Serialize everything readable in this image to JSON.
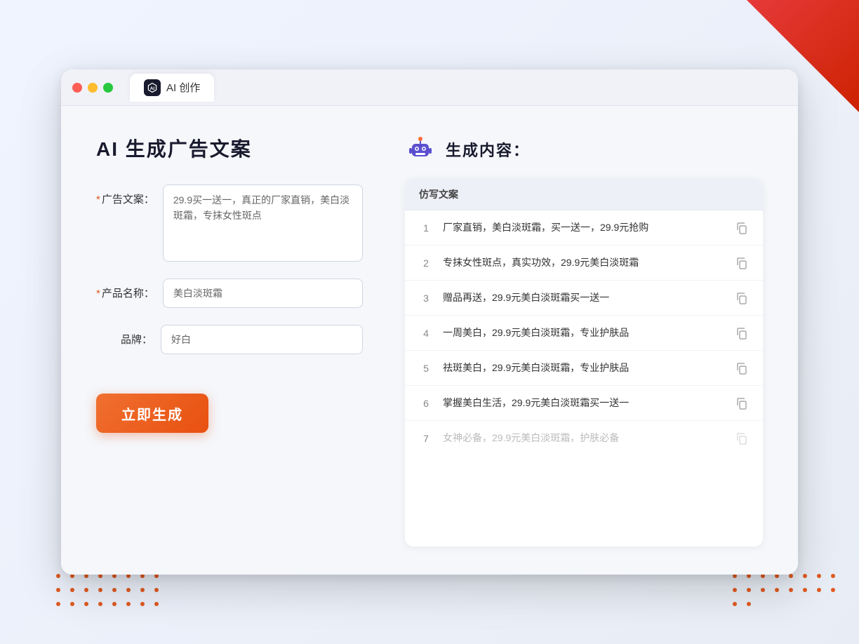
{
  "window": {
    "tab_label": "AI 创作"
  },
  "left_panel": {
    "title": "AI 生成广告文案",
    "form": {
      "ad_copy_label": "广告文案：",
      "ad_copy_required": "*",
      "ad_copy_value": "29.9买一送一，真正的厂家直销，美白淡斑霜，专抹女性斑点",
      "product_name_label": "产品名称：",
      "product_name_required": "*",
      "product_name_value": "美白淡斑霜",
      "brand_label": "品牌：",
      "brand_value": "好白"
    },
    "generate_button": "立即生成"
  },
  "right_panel": {
    "title": "生成内容：",
    "table_header": "仿写文案",
    "results": [
      {
        "num": "1",
        "text": "厂家直销，美白淡斑霜，买一送一，29.9元抢购",
        "dimmed": false
      },
      {
        "num": "2",
        "text": "专抹女性斑点，真实功效，29.9元美白淡斑霜",
        "dimmed": false
      },
      {
        "num": "3",
        "text": "赠品再送，29.9元美白淡斑霜买一送一",
        "dimmed": false
      },
      {
        "num": "4",
        "text": "一周美白，29.9元美白淡斑霜，专业护肤品",
        "dimmed": false
      },
      {
        "num": "5",
        "text": "祛斑美白，29.9元美白淡斑霜，专业护肤品",
        "dimmed": false
      },
      {
        "num": "6",
        "text": "掌握美白生活，29.9元美白淡斑霜买一送一",
        "dimmed": false
      },
      {
        "num": "7",
        "text": "女神必备，29.9元美白淡斑霜，护肤必备",
        "dimmed": true
      }
    ]
  },
  "colors": {
    "accent_orange": "#f07030",
    "accent_blue": "#6b7bff",
    "close_btn": "#ff5f57",
    "minimize_btn": "#febc2e",
    "maximize_btn": "#28c840"
  }
}
